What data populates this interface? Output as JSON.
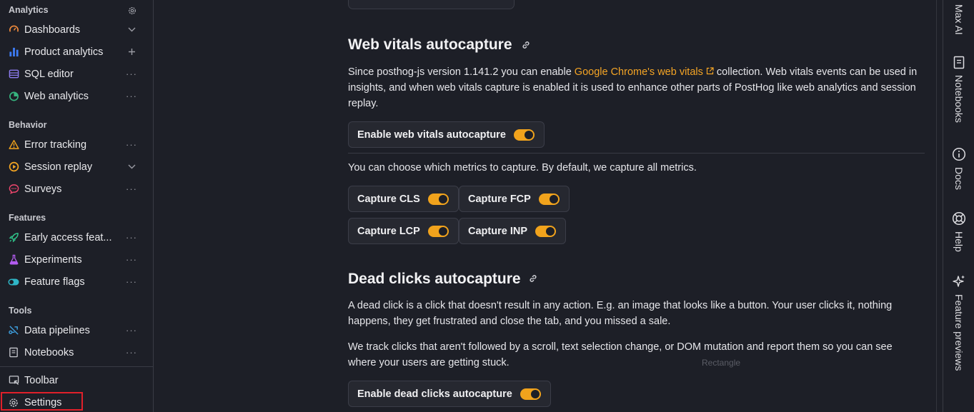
{
  "sidebar": {
    "sections": [
      {
        "title": "Analytics"
      },
      {
        "title": "Behavior"
      },
      {
        "title": "Features"
      },
      {
        "title": "Tools"
      }
    ],
    "items": [
      {
        "label": "Dashboards",
        "icon": "dashboards-icon",
        "trailing": "chevron"
      },
      {
        "label": "Product analytics",
        "icon": "product-analytics-icon",
        "trailing": "plus"
      },
      {
        "label": "SQL editor",
        "icon": "sql-editor-icon",
        "trailing": "more"
      },
      {
        "label": "Web analytics",
        "icon": "web-analytics-icon",
        "trailing": "more"
      },
      {
        "label": "Error tracking",
        "icon": "warning-icon",
        "trailing": "more"
      },
      {
        "label": "Session replay",
        "icon": "session-replay-icon",
        "trailing": "chevron"
      },
      {
        "label": "Surveys",
        "icon": "surveys-icon",
        "trailing": "more"
      },
      {
        "label": "Early access feat...",
        "icon": "rocket-icon",
        "trailing": "more"
      },
      {
        "label": "Experiments",
        "icon": "flask-icon",
        "trailing": "more"
      },
      {
        "label": "Feature flags",
        "icon": "toggle-icon",
        "trailing": "more"
      },
      {
        "label": "Data pipelines",
        "icon": "data-pipelines-icon",
        "trailing": "more"
      },
      {
        "label": "Notebooks",
        "icon": "notebook-icon",
        "trailing": "more"
      }
    ],
    "toolbar_label": "Toolbar",
    "settings_label": "Settings"
  },
  "main": {
    "web_vitals": {
      "title": "Web vitals autocapture",
      "desc_before": "Since posthog-js version 1.141.2 you can enable ",
      "desc_link": "Google Chrome's web vitals",
      "desc_after": " collection. Web vitals events can be used in insights, and when web vitals capture is enabled it is used to enhance other parts of PostHog like web analytics and session replay.",
      "toggle_label": "Enable web vitals autocapture",
      "metrics_text": "You can choose which metrics to capture. By default, we capture all metrics.",
      "metrics": [
        {
          "label": "Capture CLS",
          "enabled": true
        },
        {
          "label": "Capture FCP",
          "enabled": true
        },
        {
          "label": "Capture LCP",
          "enabled": true
        },
        {
          "label": "Capture INP",
          "enabled": true
        }
      ]
    },
    "dead_clicks": {
      "title": "Dead clicks autocapture",
      "desc1": "A dead click is a click that doesn't result in any action. E.g. an image that looks like a button. Your user clicks it, nothing happens, they get frustrated and close the tab, and you missed a sale.",
      "desc2": "We track clicks that aren't followed by a scroll, text selection change, or DOM mutation and report them so you can see where your users are getting stuck.",
      "toggle_label": "Enable dead clicks autocapture"
    },
    "ghost_label": "Rectangle"
  },
  "rightbar": {
    "items": [
      {
        "label": "Max AI",
        "icon": "max-ai-icon"
      },
      {
        "label": "Notebooks",
        "icon": "notebook-icon"
      },
      {
        "label": "Docs",
        "icon": "info-icon"
      },
      {
        "label": "Help",
        "icon": "lifebuoy-icon"
      },
      {
        "label": "Feature previews",
        "icon": "sparkle-icon"
      }
    ]
  },
  "colors": {
    "accent": "#f1a31c",
    "link": "#f4a425",
    "background": "#1d1f27",
    "highlight_border": "#e0202a"
  }
}
